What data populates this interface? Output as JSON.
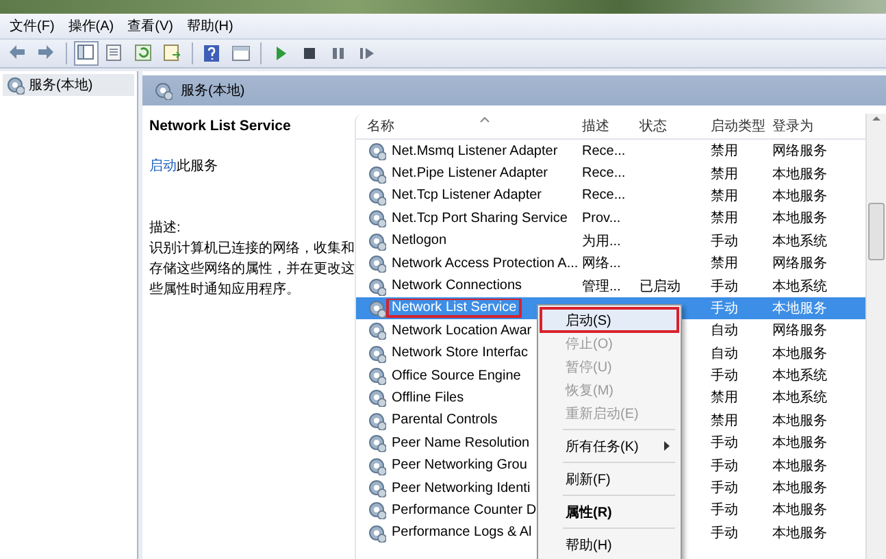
{
  "menu_bar": [
    "文件(F)",
    "操作(A)",
    "查看(V)",
    "帮助(H)"
  ],
  "toolbar": [
    {
      "kind": "back"
    },
    {
      "kind": "forward"
    },
    {
      "kind": "separator"
    },
    {
      "kind": "tree",
      "selected": true
    },
    {
      "kind": "export",
      "selected": false
    },
    {
      "kind": "refresh",
      "selected": false
    },
    {
      "kind": "list",
      "selected": false
    },
    {
      "kind": "separator"
    },
    {
      "kind": "help",
      "selected": false
    },
    {
      "kind": "view",
      "selected": false
    },
    {
      "kind": "separator"
    },
    {
      "kind": "play",
      "selected": false
    },
    {
      "kind": "stop",
      "selected": false
    },
    {
      "kind": "pause",
      "selected": false
    },
    {
      "kind": "resume",
      "selected": false
    }
  ],
  "tree": {
    "items": [
      {
        "label": "服务(本地)",
        "selected": true
      }
    ]
  },
  "panel": {
    "title": "服务(本地)"
  },
  "details": {
    "service_name": "Network List Service",
    "action_link": "启动",
    "action_text": "此服务",
    "description_label": "描述:",
    "description": "识别计算机已连接的网络，收集和存储这些网络的属性，并在更改这些属性时通知应用程序。"
  },
  "table": {
    "columns": [
      "名称",
      "描述",
      "状态",
      "启动类型",
      "登录为"
    ],
    "rows": [
      {
        "name": "Net.Msmq Listener Adapter",
        "description": "Rece...",
        "status": "",
        "startup_type": "禁用",
        "log_on_as": "网络服务",
        "selected": false
      },
      {
        "name": "Net.Pipe Listener Adapter",
        "description": "Rece...",
        "status": "",
        "startup_type": "禁用",
        "log_on_as": "本地服务",
        "selected": false
      },
      {
        "name": "Net.Tcp Listener Adapter",
        "description": "Rece...",
        "status": "",
        "startup_type": "禁用",
        "log_on_as": "本地服务",
        "selected": false
      },
      {
        "name": "Net.Tcp Port Sharing Service",
        "description": "Prov...",
        "status": "",
        "startup_type": "禁用",
        "log_on_as": "本地服务",
        "selected": false
      },
      {
        "name": "Netlogon",
        "description": "为用...",
        "status": "",
        "startup_type": "手动",
        "log_on_as": "本地系统",
        "selected": false
      },
      {
        "name": "Network Access Protection A...",
        "description": "网络...",
        "status": "",
        "startup_type": "禁用",
        "log_on_as": "网络服务",
        "selected": false
      },
      {
        "name": "Network Connections",
        "description": "管理...",
        "status": "已启动",
        "startup_type": "手动",
        "log_on_as": "本地系统",
        "selected": false
      },
      {
        "name": "Network List Service",
        "description": "",
        "status": "",
        "startup_type": "手动",
        "log_on_as": "本地服务",
        "selected": true
      },
      {
        "name": "Network Location Awar",
        "description": "",
        "status": "",
        "startup_type": "自动",
        "log_on_as": "网络服务",
        "selected": false
      },
      {
        "name": "Network Store Interfac",
        "description": "",
        "status": "",
        "startup_type": "自动",
        "log_on_as": "本地服务",
        "selected": false
      },
      {
        "name": "Office Source Engine",
        "description": "",
        "status": "",
        "startup_type": "手动",
        "log_on_as": "本地系统",
        "selected": false
      },
      {
        "name": "Offline Files",
        "description": "",
        "status": "",
        "startup_type": "禁用",
        "log_on_as": "本地系统",
        "selected": false
      },
      {
        "name": "Parental Controls",
        "description": "",
        "status": "",
        "startup_type": "禁用",
        "log_on_as": "本地服务",
        "selected": false
      },
      {
        "name": "Peer Name Resolution",
        "description": "",
        "status": "",
        "startup_type": "手动",
        "log_on_as": "本地服务",
        "selected": false
      },
      {
        "name": "Peer Networking Grou",
        "description": "",
        "status": "",
        "startup_type": "手动",
        "log_on_as": "本地服务",
        "selected": false
      },
      {
        "name": "Peer Networking Identi",
        "description": "",
        "status": "",
        "startup_type": "手动",
        "log_on_as": "本地服务",
        "selected": false
      },
      {
        "name": "Performance Counter D",
        "description": "",
        "status": "",
        "startup_type": "手动",
        "log_on_as": "本地服务",
        "selected": false
      },
      {
        "name": "Performance Logs & Al",
        "description": "",
        "status": "",
        "startup_type": "手动",
        "log_on_as": "本地服务",
        "selected": false
      }
    ]
  },
  "context_menu": [
    {
      "kind": "item",
      "label": "启动(S)",
      "disabled": false,
      "selected": true,
      "bold": false,
      "submenu": false
    },
    {
      "kind": "item",
      "label": "停止(O)",
      "disabled": true,
      "selected": false,
      "bold": false,
      "submenu": false
    },
    {
      "kind": "item",
      "label": "暂停(U)",
      "disabled": true,
      "selected": false,
      "bold": false,
      "submenu": false
    },
    {
      "kind": "item",
      "label": "恢复(M)",
      "disabled": true,
      "selected": false,
      "bold": false,
      "submenu": false
    },
    {
      "kind": "item",
      "label": "重新启动(E)",
      "disabled": true,
      "selected": false,
      "bold": false,
      "submenu": false
    },
    {
      "kind": "separator"
    },
    {
      "kind": "item",
      "label": "所有任务(K)",
      "disabled": false,
      "selected": false,
      "bold": false,
      "submenu": true
    },
    {
      "kind": "separator"
    },
    {
      "kind": "item",
      "label": "刷新(F)",
      "disabled": false,
      "selected": false,
      "bold": false,
      "submenu": false
    },
    {
      "kind": "separator"
    },
    {
      "kind": "item",
      "label": "属性(R)",
      "disabled": false,
      "selected": false,
      "bold": true,
      "submenu": false
    },
    {
      "kind": "separator"
    },
    {
      "kind": "item",
      "label": "帮助(H)",
      "disabled": false,
      "selected": false,
      "bold": false,
      "submenu": false
    }
  ]
}
